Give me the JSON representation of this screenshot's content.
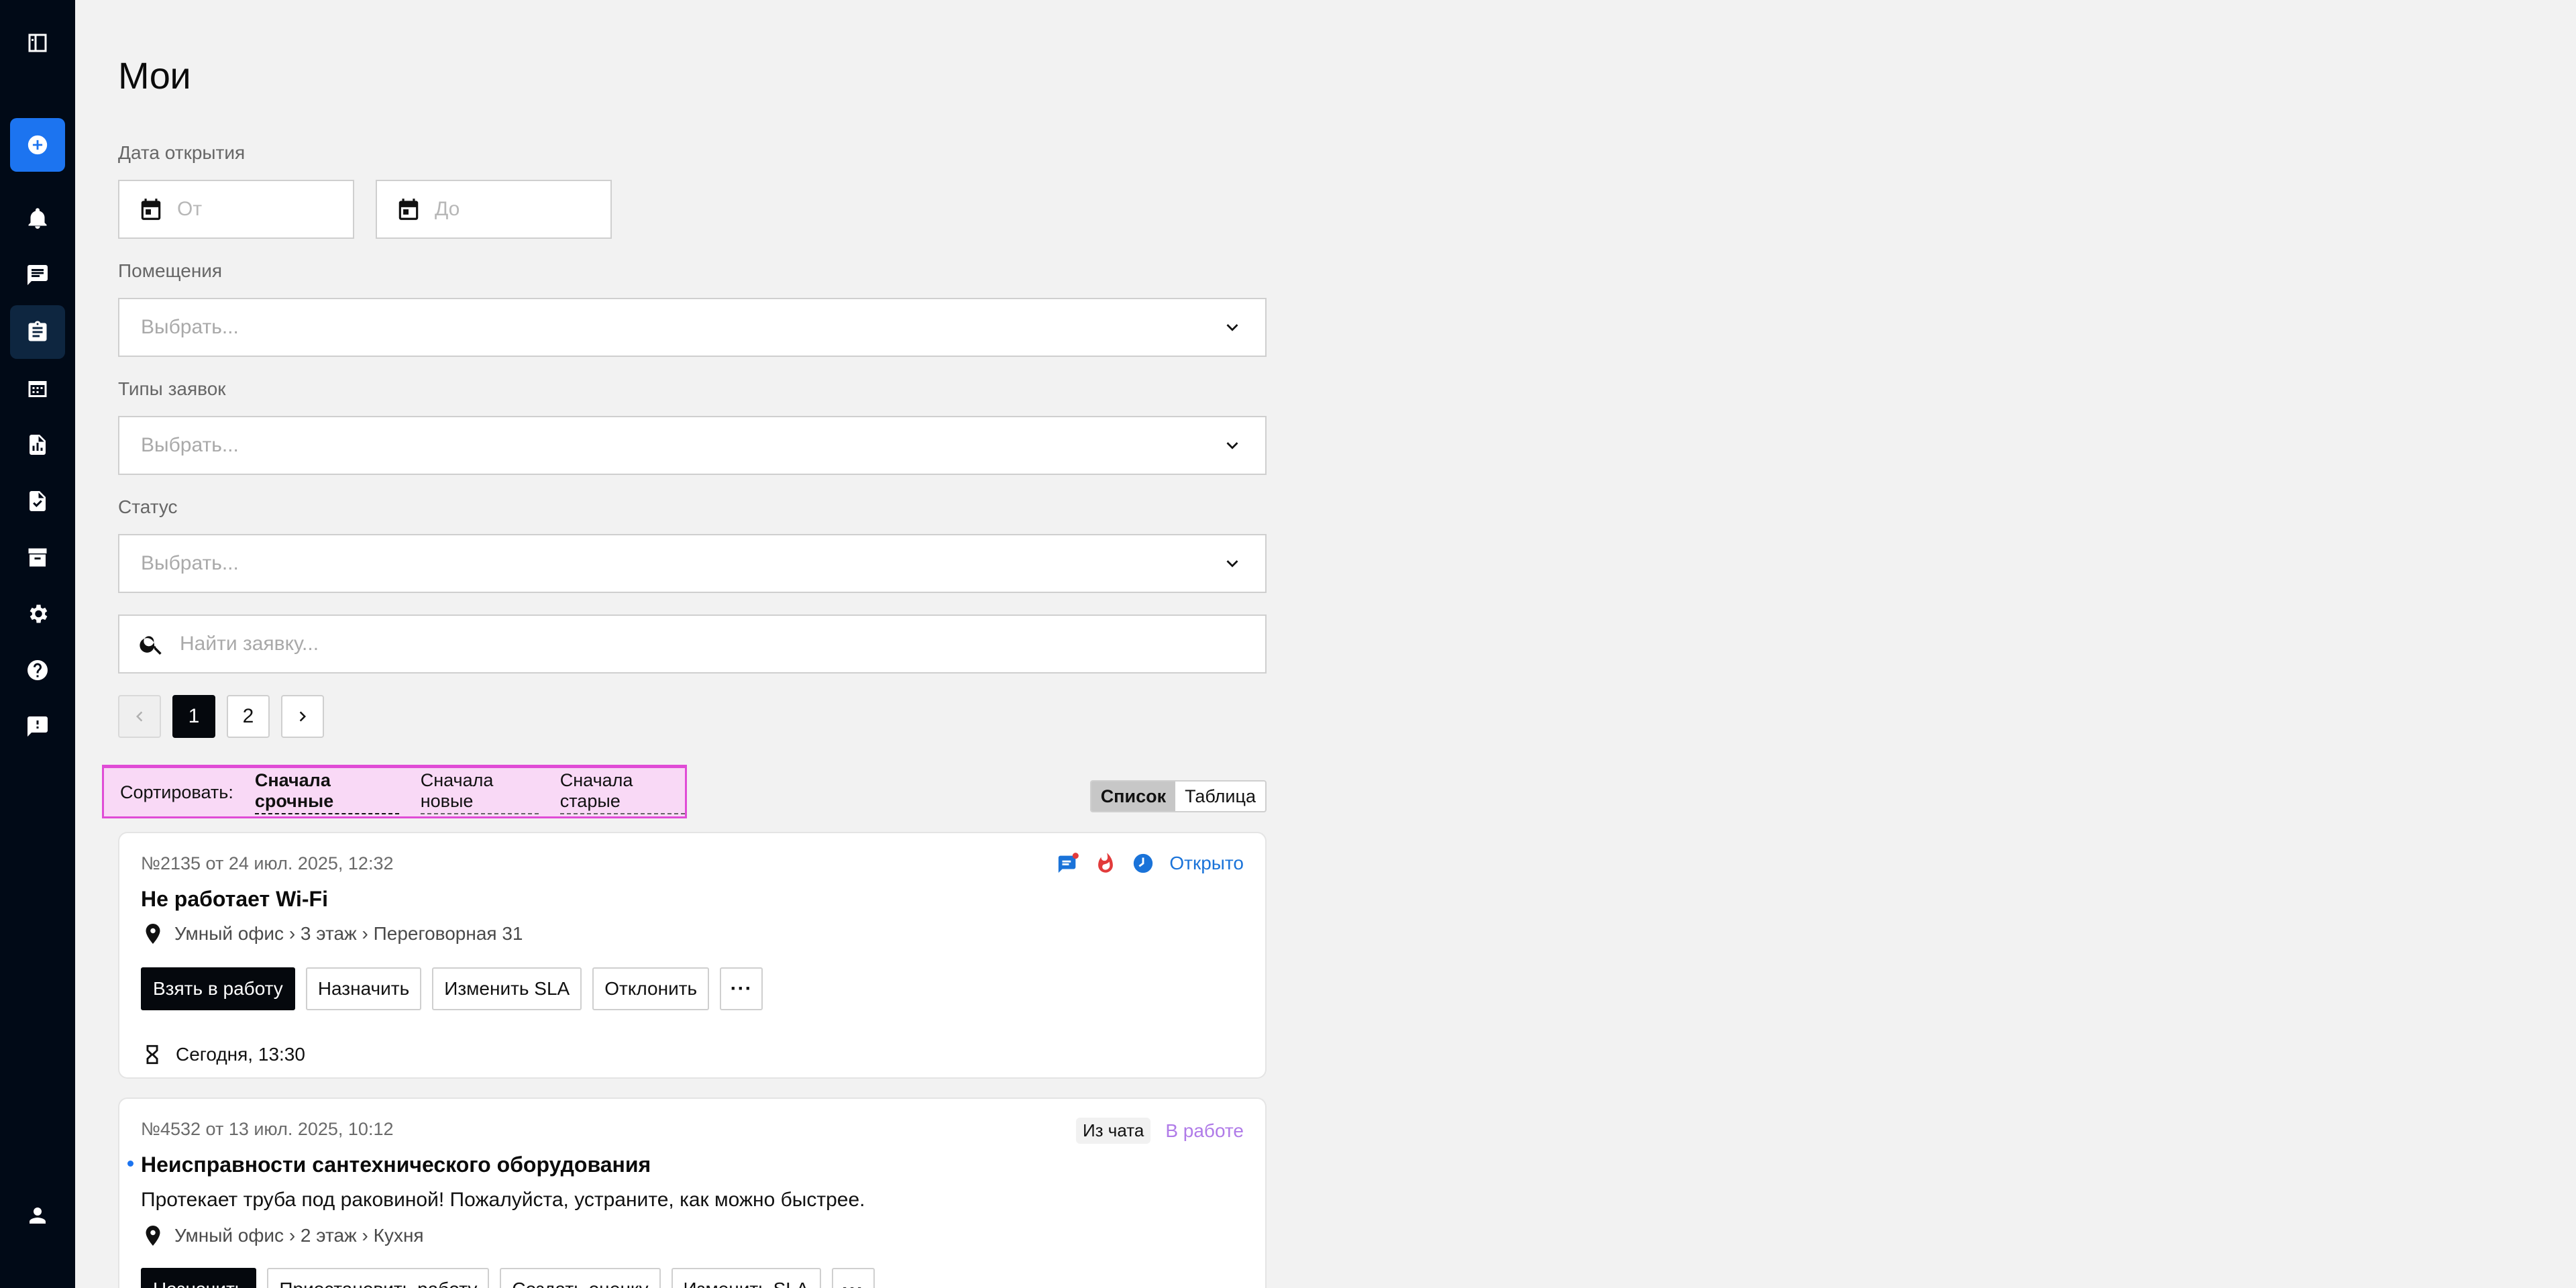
{
  "sidebar": {
    "items": [
      {
        "icon": "sidebar-toggle-icon",
        "active": false
      },
      {
        "icon": "plus-circle-icon",
        "active": false
      },
      {
        "icon": "bell-icon",
        "active": false
      },
      {
        "icon": "chat-icon",
        "active": false
      },
      {
        "icon": "clipboard-icon",
        "active": true
      },
      {
        "icon": "calendar-icon",
        "active": false
      },
      {
        "icon": "report-icon",
        "active": false
      },
      {
        "icon": "document-check-icon",
        "active": false
      },
      {
        "icon": "archive-icon",
        "active": false
      },
      {
        "icon": "gear-icon",
        "active": false
      },
      {
        "icon": "help-icon",
        "active": false
      },
      {
        "icon": "feedback-icon",
        "active": false
      },
      {
        "icon": "user-icon",
        "active": false
      }
    ]
  },
  "page": {
    "title": "Мои"
  },
  "filters": {
    "date_label": "Дата открытия",
    "date_from_placeholder": "От",
    "date_to_placeholder": "До",
    "rooms_label": "Помещения",
    "rooms_placeholder": "Выбрать...",
    "types_label": "Типы заявок",
    "types_placeholder": "Выбрать...",
    "status_label": "Статус",
    "status_placeholder": "Выбрать...",
    "search_placeholder": "Найти заявку..."
  },
  "pagination": {
    "pages": [
      "1",
      "2"
    ],
    "current": "1"
  },
  "sort": {
    "label": "Сортировать:",
    "options": [
      "Сначала срочные",
      "Сначала новые",
      "Сначала старые"
    ],
    "active": "Сначала срочные"
  },
  "view": {
    "list": "Список",
    "table": "Таблица",
    "active": "Список"
  },
  "colors": {
    "accent": "#1c74f0",
    "status_open": "#1a73d9",
    "status_in_work": "#b07be8",
    "urgent": "#e23b3b",
    "sort_highlight": "#e04cd6"
  },
  "tickets": [
    {
      "meta": "№2135 от 24 июл. 2025, 12:32",
      "title": "Не работает Wi-Fi",
      "location": "Умный офис › 3 этаж › Переговорная 31",
      "status": "Открыто",
      "icons": [
        "new-message-icon",
        "fire-icon",
        "clock-icon"
      ],
      "actions": [
        "Взять в работу",
        "Назначить",
        "Изменить SLA",
        "Отклонить"
      ],
      "deadline": "Сегодня, 13:30"
    },
    {
      "meta": "№4532 от 13 июл. 2025, 10:12",
      "title": "Неисправности сантехнического оборудования",
      "description": "Протекает труба под раковиной! Пожалуйста, устраните, как можно быстрее.",
      "location": "Умный офис › 2 этаж › Кухня",
      "source_chip": "Из чата",
      "status": "В работе",
      "actions": [
        "Назначить",
        "Приостановить работу",
        "Создать оценку",
        "Изменить SLA"
      ]
    }
  ]
}
